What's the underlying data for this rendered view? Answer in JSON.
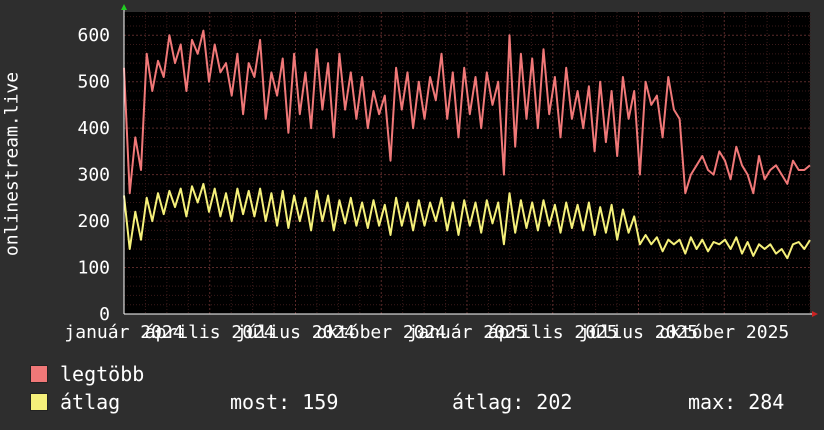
{
  "colors": {
    "background": "#2e2e2e",
    "plot_background": "#000000",
    "grid_minor": "#3a1a1a",
    "grid_major": "#5a2a2a",
    "axis": "#ffffff",
    "max_series": "#f07878",
    "avg_series": "#f5f07a"
  },
  "chart_data": {
    "type": "line",
    "ylabel": "onlinestream.live",
    "ylim": [
      0,
      650
    ],
    "yticks": [
      0,
      100,
      200,
      300,
      400,
      500,
      600
    ],
    "xlim": [
      0,
      100
    ],
    "xticks": [
      {
        "x": 0,
        "label": "január 2024"
      },
      {
        "x": 12.5,
        "label": "április 2024"
      },
      {
        "x": 25,
        "label": "július 2024"
      },
      {
        "x": 37.5,
        "label": "október 2024"
      },
      {
        "x": 50,
        "label": "január 2025"
      },
      {
        "x": 62.5,
        "label": "április 2025"
      },
      {
        "x": 75,
        "label": "július 2025"
      },
      {
        "x": 87.5,
        "label": "október 2025"
      }
    ],
    "grid": true,
    "series": [
      {
        "name": "legtöbb",
        "color": "#f07878",
        "values": [
          530,
          260,
          380,
          310,
          560,
          480,
          545,
          510,
          600,
          540,
          580,
          480,
          590,
          560,
          610,
          500,
          580,
          520,
          540,
          470,
          560,
          430,
          540,
          510,
          590,
          420,
          520,
          470,
          550,
          390,
          560,
          430,
          520,
          400,
          570,
          440,
          540,
          380,
          560,
          440,
          520,
          420,
          510,
          400,
          480,
          430,
          470,
          330,
          530,
          440,
          520,
          400,
          500,
          420,
          510,
          460,
          560,
          420,
          520,
          380,
          530,
          430,
          510,
          400,
          520,
          450,
          500,
          300,
          600,
          360,
          560,
          420,
          550,
          400,
          570,
          430,
          510,
          380,
          530,
          420,
          480,
          400,
          490,
          350,
          500,
          370,
          480,
          340,
          510,
          420,
          480,
          300,
          500,
          450,
          470,
          380,
          510,
          440,
          420,
          260,
          300,
          320,
          340,
          310,
          300,
          350,
          330,
          290,
          360,
          320,
          300,
          260,
          340,
          290,
          310,
          320,
          300,
          280,
          330,
          310,
          310,
          320
        ]
      },
      {
        "name": "átlag",
        "color": "#f5f07a",
        "values": [
          255,
          140,
          220,
          160,
          250,
          200,
          260,
          215,
          265,
          230,
          270,
          210,
          275,
          240,
          280,
          220,
          270,
          210,
          260,
          200,
          270,
          215,
          265,
          210,
          270,
          200,
          260,
          190,
          265,
          185,
          255,
          200,
          250,
          180,
          265,
          200,
          255,
          180,
          245,
          195,
          250,
          190,
          240,
          185,
          245,
          190,
          235,
          170,
          250,
          190,
          240,
          180,
          245,
          190,
          240,
          200,
          250,
          180,
          240,
          170,
          245,
          190,
          240,
          175,
          245,
          195,
          240,
          150,
          260,
          175,
          245,
          185,
          240,
          180,
          245,
          190,
          235,
          175,
          240,
          185,
          235,
          180,
          240,
          170,
          230,
          175,
          235,
          160,
          225,
          175,
          210,
          150,
          170,
          150,
          165,
          135,
          160,
          150,
          160,
          130,
          165,
          140,
          160,
          135,
          155,
          150,
          160,
          140,
          165,
          130,
          155,
          125,
          150,
          140,
          150,
          130,
          140,
          120,
          150,
          155,
          140,
          159
        ]
      }
    ]
  },
  "legend": {
    "items": [
      {
        "label": "legtöbb",
        "color": "#f07878"
      },
      {
        "label": "átlag",
        "color": "#f5f07a"
      }
    ]
  },
  "stats": {
    "current": "most: 159",
    "average": "átlag: 202",
    "max": "max: 284"
  }
}
